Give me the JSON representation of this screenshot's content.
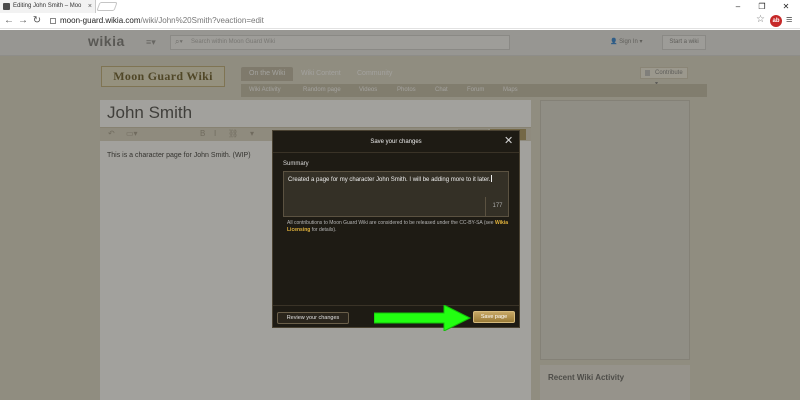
{
  "browser": {
    "tab_title": "Editing John Smith – Moo",
    "tab_close": "×",
    "window_controls": {
      "minimize": "–",
      "maximize": "❐",
      "close": "✕"
    },
    "url_host": "moon-guard.wikia.com",
    "url_path": "/wiki/John%20Smith?veaction=edit",
    "extension_badge": "ab"
  },
  "wikia_bar": {
    "logo": "wikia",
    "search_placeholder": "Search within Moon Guard Wiki",
    "sign_in": "Sign In ▾",
    "start_wiki": "Start a wiki"
  },
  "wiki_header": {
    "wordmark": "Moon Guard Wiki",
    "tabs": [
      "On the Wiki",
      "Wiki Content",
      "Community"
    ],
    "contribute": "Contribute ▾",
    "subnav": [
      "Wiki Activity",
      "Random page",
      "Videos",
      "Photos",
      "Chat",
      "Forum",
      "Maps"
    ]
  },
  "article": {
    "title": "John Smith",
    "body": "This is a character page for John Smith. (WIP)"
  },
  "rail": {
    "heading": "Recent Wiki Activity"
  },
  "modal": {
    "title": "Save your changes",
    "summary_label": "Summary",
    "summary_text": "Created a page for my character John Smith. I will be adding more to it later.",
    "char_count": "177",
    "license_prefix": "All contributions to Moon Guard Wiki are considered to be released under the CC-BY-SA (see ",
    "license_link": "Wikia Licensing",
    "license_suffix": " for details).",
    "review_button": "Review your changes",
    "save_button": "Save page"
  },
  "colors": {
    "annotation_arrow": "#22ff11",
    "save_button": "#b5954f",
    "modal_bg": "#1e1b14"
  }
}
